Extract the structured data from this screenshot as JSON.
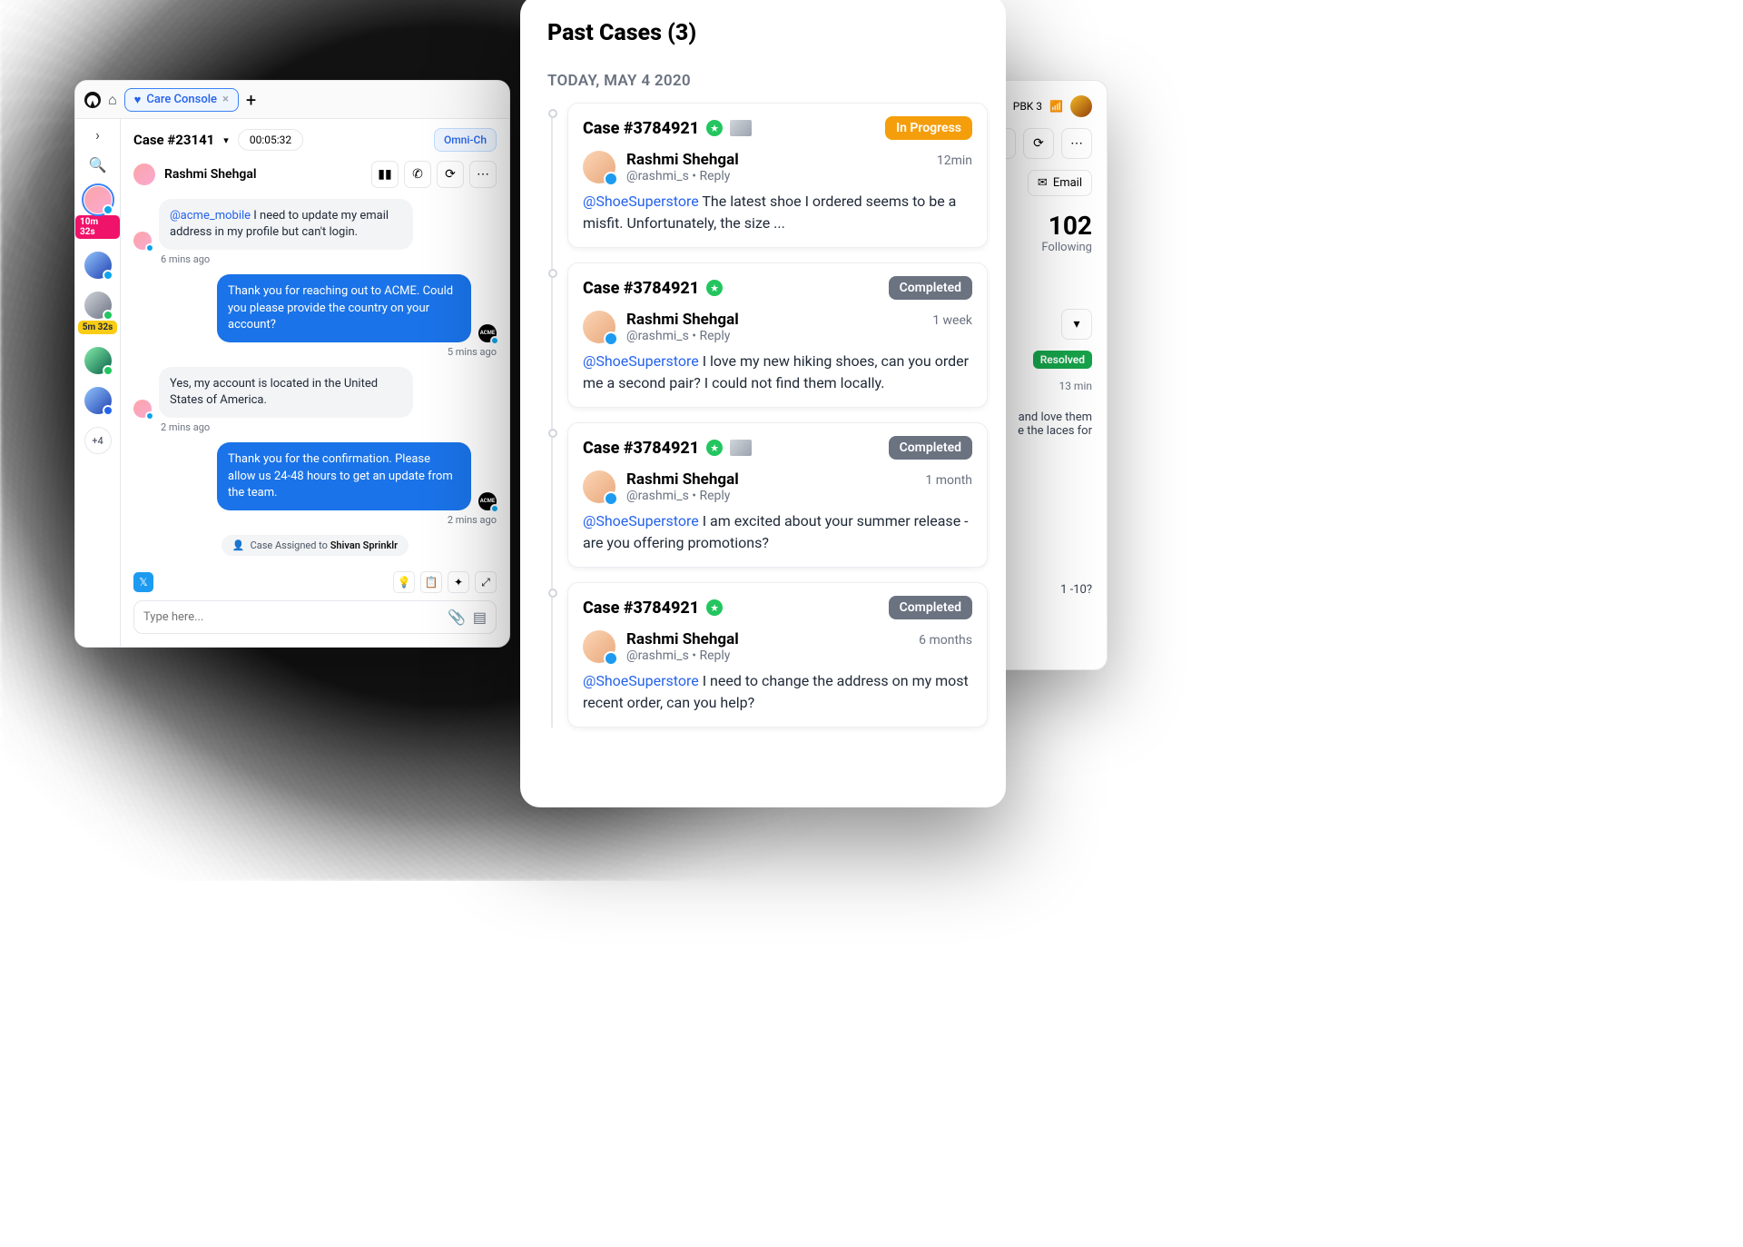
{
  "topbar": {
    "tab_label": "Care Console",
    "add_label": "+"
  },
  "sidebar": {
    "timer_badge_1": "10m 32s",
    "timer_badge_2": "5m 32s",
    "more_label": "+4"
  },
  "header": {
    "case_label": "Case #23141",
    "timer": "00:05:32",
    "omni_label": "Omni-Ch"
  },
  "contact": {
    "name": "Rashmi Shehgal"
  },
  "chat": {
    "m1_mention": "@acme_mobile",
    "m1_text": "  I need to update my email address in my profile but can't login.",
    "t1": "6 mins ago",
    "m2_text": "Thank you for reaching out to ACME. Could you please provide the country on your account?",
    "t2": "5 mins ago",
    "m3_text": "Yes, my account is located in the United States of America.",
    "t3": "2 mins ago",
    "m4_text": "Thank you for the confirmation. Please allow us 24-48 hours to get an update from the team.",
    "t4": "2 mins ago",
    "assigned_prefix": "Case Assigned to ",
    "assigned_name": "Shivan Sprinklr"
  },
  "compose": {
    "placeholder": "Type here..."
  },
  "right_win": {
    "net": "PBK 3",
    "email_label": "Email",
    "stat_value": "102",
    "stat_label": "Following",
    "resolved": "Resolved",
    "resolved_time": "13 min",
    "snippet1": "and love them",
    "snippet2": "e the laces for",
    "snippet3": "1 -10?"
  },
  "panel": {
    "title": "Past Cases (3)",
    "date": "TODAY, MAY 4 2020",
    "cases": [
      {
        "id": "Case #3784921",
        "status": "In Progress",
        "status_class": "s-prog",
        "thumb": true,
        "name": "Rashmi Shehgal",
        "handle": "@rashmi_s • Reply",
        "time": "12min",
        "mention": "@ShoeSuperstore",
        "text": " The latest shoe I ordered seems to be a misfit. Unfortunately, the size ..."
      },
      {
        "id": "Case #3784921",
        "status": "Completed",
        "status_class": "s-done",
        "thumb": false,
        "name": "Rashmi Shehgal",
        "handle": "@rashmi_s • Reply",
        "time": "1 week",
        "mention": "@ShoeSuperstore",
        "text": " I love my new hiking shoes, can you order me a second pair? I could not find them locally."
      },
      {
        "id": "Case #3784921",
        "status": "Completed",
        "status_class": "s-done",
        "thumb": true,
        "name": "Rashmi Shehgal",
        "handle": "@rashmi_s • Reply",
        "time": "1 month",
        "mention": "@ShoeSuperstore",
        "text": " I am excited about your summer release - are you offering promotions?"
      },
      {
        "id": "Case #3784921",
        "status": "Completed",
        "status_class": "s-done",
        "thumb": false,
        "name": "Rashmi Shehgal",
        "handle": "@rashmi_s • Reply",
        "time": "6 months",
        "mention": "@ShoeSuperstore",
        "text": " I need to change the address on my most recent order, can you help?"
      }
    ]
  }
}
